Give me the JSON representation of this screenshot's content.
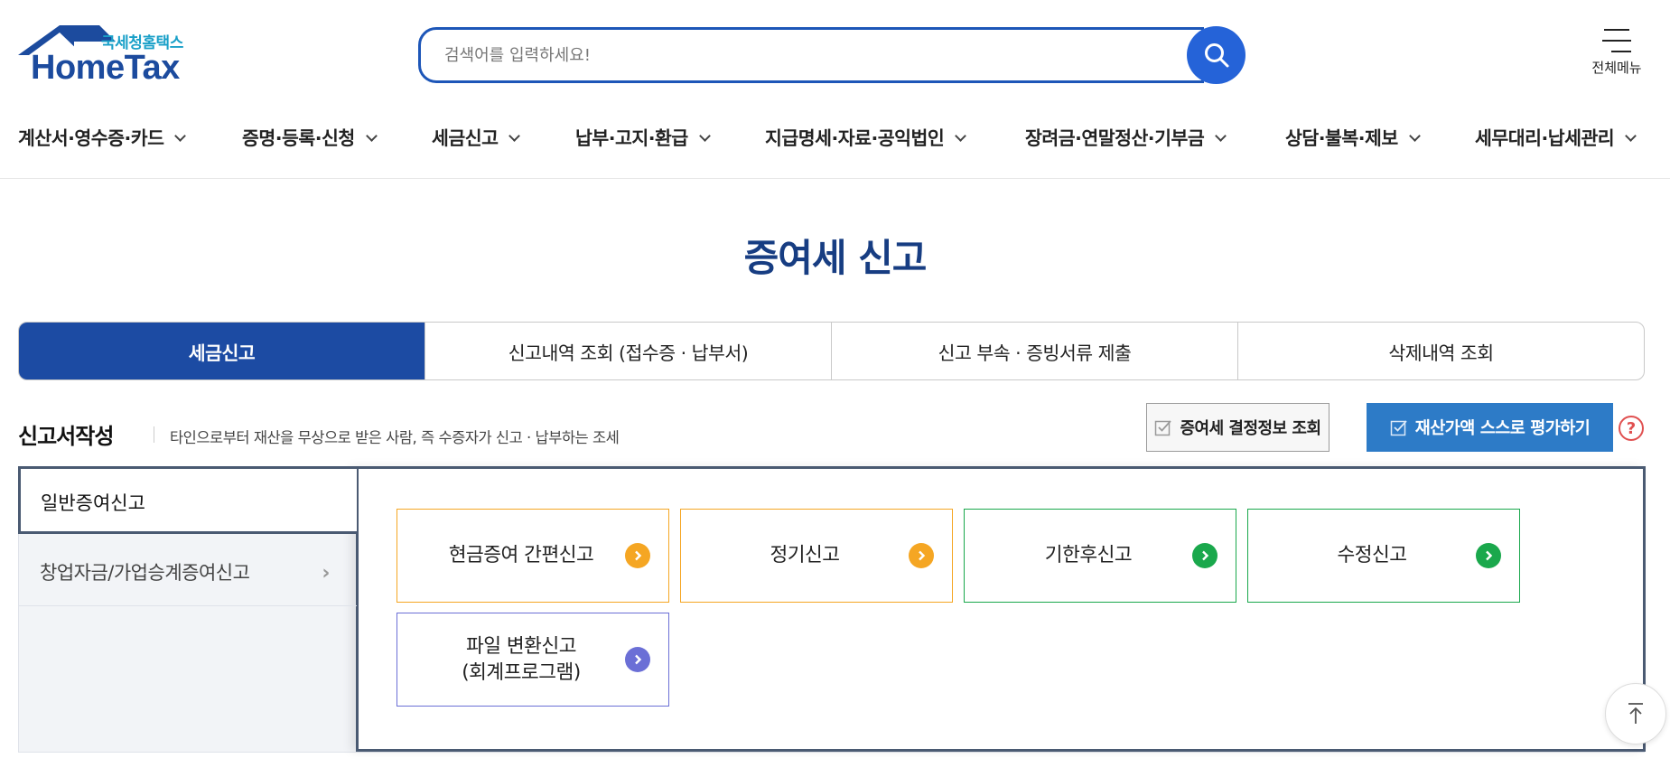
{
  "logo": {
    "sub": "국세청홈택스",
    "main": "HomeTax"
  },
  "search": {
    "placeholder": "검색어를 입력하세요!",
    "icon": "search-icon"
  },
  "menu": {
    "label": "전체메뉴",
    "icon": "hamburger-icon"
  },
  "gnb": [
    {
      "label": "계산서·영수증·카드"
    },
    {
      "label": "증명·등록·신청"
    },
    {
      "label": "세금신고"
    },
    {
      "label": "납부·고지·환급"
    },
    {
      "label": "지급명세·자료·공익법인"
    },
    {
      "label": "장려금·연말정산·기부금"
    },
    {
      "label": "상담·불복·제보"
    },
    {
      "label": "세무대리·납세관리"
    }
  ],
  "page_title": "증여세 신고",
  "tabs": [
    {
      "label": "세금신고",
      "active": true
    },
    {
      "label": "신고내역 조회 (접수증 · 납부서)",
      "active": false
    },
    {
      "label": "신고 부속 · 증빙서류 제출",
      "active": false
    },
    {
      "label": "삭제내역 조회",
      "active": false
    }
  ],
  "section": {
    "title": "신고서작성",
    "desc": "타인으로부터 재산을 무상으로 받은 사람, 즉 수증자가 신고 · 납부하는 조세"
  },
  "actions": {
    "lookup_label": "증여세 결정정보 조회",
    "eval_label": "재산가액 스스로 평가하기",
    "help": "?"
  },
  "side_nav": [
    {
      "label": "일반증여신고",
      "active": true
    },
    {
      "label": "창업자금/가업승계증여신고",
      "active": false
    }
  ],
  "cards": [
    {
      "label": "현금증여 간편신고",
      "color": "#f5a623"
    },
    {
      "label": "정기신고",
      "color": "#f5a623"
    },
    {
      "label": "기한후신고",
      "color": "#1aa84c"
    },
    {
      "label": "수정신고",
      "color": "#1aa84c"
    },
    {
      "label": "파일 변환신고\n(회계프로그램)",
      "color": "#6b6fd6"
    }
  ],
  "colors": {
    "brand": "#1c4ba3",
    "eval_button": "#2d7bc7",
    "orange": "#f5a623",
    "green": "#1aa84c",
    "purple": "#6b6fd6"
  }
}
